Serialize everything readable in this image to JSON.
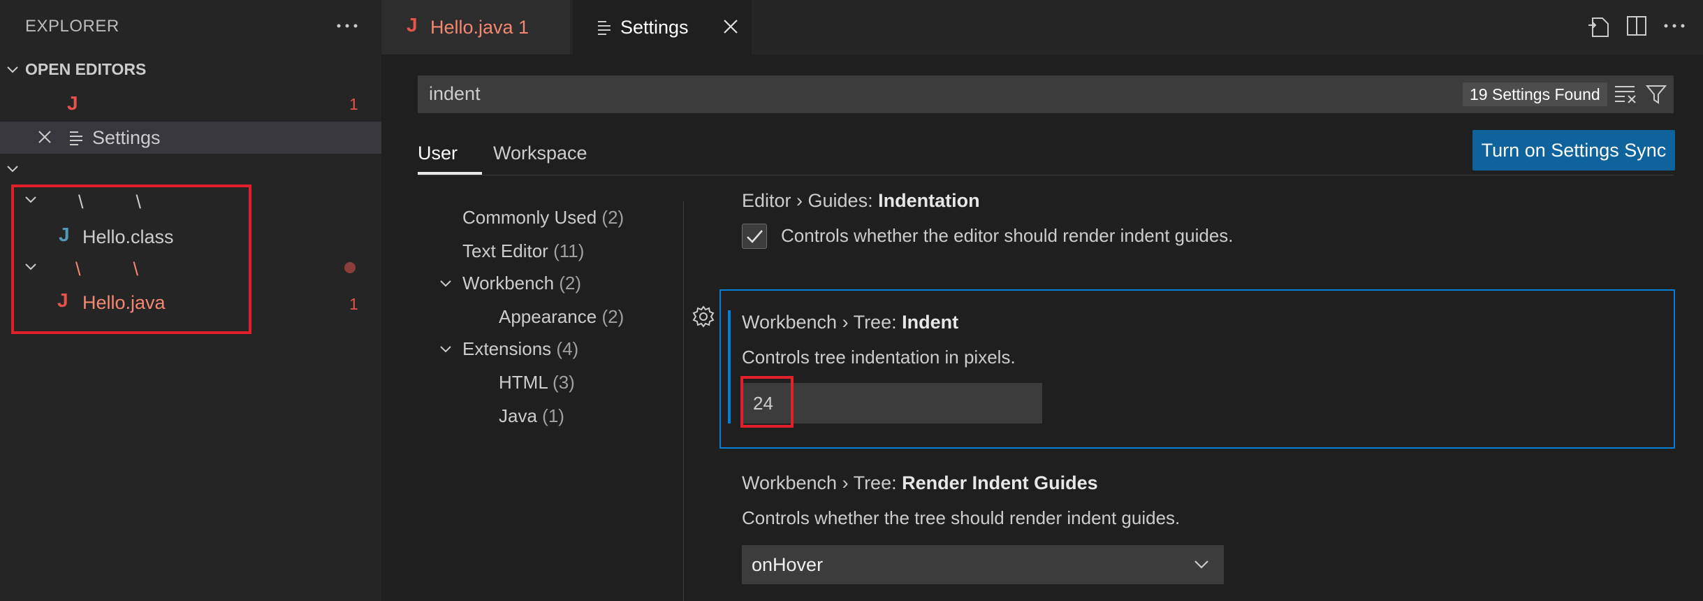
{
  "sidebar": {
    "title": "EXPLORER",
    "open_editors": {
      "header": "OPEN EDITORS",
      "items": [
        {
          "label": "",
          "badge": "1"
        },
        {
          "label": "Settings"
        }
      ]
    },
    "tree": {
      "folder1_path": "\\          \\",
      "file1": "Hello.class",
      "folder2_path": "\\          \\",
      "file2": "Hello.java",
      "file2_badge": "1"
    }
  },
  "tabs": [
    {
      "label": "Hello.java 1"
    },
    {
      "label": "Settings"
    }
  ],
  "settings": {
    "search_value": "indent",
    "found": "19 Settings Found",
    "scope_tabs": [
      "User",
      "Workspace"
    ],
    "sync_button": "Turn on Settings Sync",
    "toc": [
      {
        "label": "Commonly Used",
        "count": "(2)"
      },
      {
        "label": "Text Editor",
        "count": "(11)"
      },
      {
        "label": "Workbench",
        "count": "(2)"
      },
      {
        "label": "Appearance",
        "count": "(2)"
      },
      {
        "label": "Extensions",
        "count": "(4)"
      },
      {
        "label": "HTML",
        "count": "(3)"
      },
      {
        "label": "Java",
        "count": "(1)"
      }
    ],
    "items": [
      {
        "title_prefix": "Editor › Guides: ",
        "title_name": "Indentation",
        "description": "Controls whether the editor should render indent guides.",
        "checked": true
      },
      {
        "title_prefix": "Workbench › Tree: ",
        "title_name": "Indent",
        "description": "Controls tree indentation in pixels.",
        "value": "24"
      },
      {
        "title_prefix": "Workbench › Tree: ",
        "title_name": "Render Indent Guides",
        "description": "Controls whether the tree should render indent guides.",
        "value": "onHover"
      }
    ]
  },
  "colors": {
    "accent_blue": "#0e639c",
    "focus_border": "#007fd4",
    "error_red": "#e5534b",
    "highlight_box": "#e1202a"
  }
}
